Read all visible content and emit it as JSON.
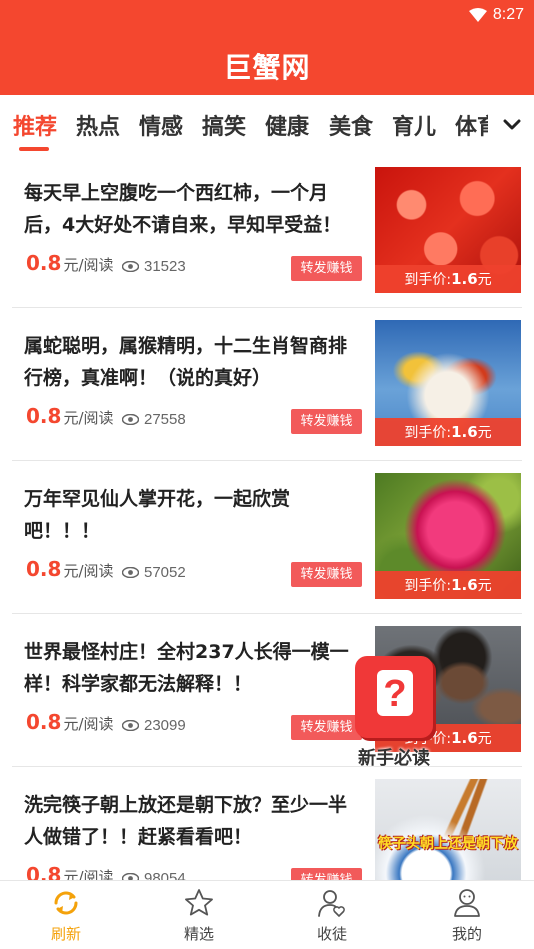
{
  "status": {
    "time": "8:27"
  },
  "header": {
    "title": "巨蟹网"
  },
  "tabs": [
    "推荐",
    "热点",
    "情感",
    "搞笑",
    "健康",
    "美食",
    "育儿",
    "体育"
  ],
  "articles": [
    {
      "title": "每天早上空腹吃一个西红柿，一个月后，4大好处不请自来，早知早受益！",
      "price": "0.8",
      "unit": "元/阅读",
      "views": "31523",
      "share": "转发赚钱",
      "cap_prefix": "到手价:",
      "cap_price": "1.6",
      "cap_unit": "元"
    },
    {
      "title": "属蛇聪明，属猴精明，十二生肖智商排行榜，真准啊！（说的真好）",
      "price": "0.8",
      "unit": "元/阅读",
      "views": "27558",
      "share": "转发赚钱",
      "cap_prefix": "到手价:",
      "cap_price": "1.6",
      "cap_unit": "元"
    },
    {
      "title": "万年罕见仙人掌开花，一起欣赏吧！！！",
      "price": "0.8",
      "unit": "元/阅读",
      "views": "57052",
      "share": "转发赚钱",
      "cap_prefix": "到手价:",
      "cap_price": "1.6",
      "cap_unit": "元"
    },
    {
      "title": "世界最怪村庄！全村237人长得一模一样！科学家都无法解释！！",
      "price": "0.8",
      "unit": "元/阅读",
      "views": "23099",
      "share": "转发赚钱",
      "cap_prefix": "到手价:",
      "cap_price": "1.6",
      "cap_unit": "元"
    },
    {
      "title": "洗完筷子朝上放还是朝下放？至少一半人做错了！！赶紧看看吧！",
      "price": "0.8",
      "unit": "元/阅读",
      "views": "98054",
      "share": "转发赚钱",
      "overlay": "筷子头朝上还是朝下放"
    }
  ],
  "help": {
    "label": "新手必读",
    "icon": "question-icon"
  },
  "nav": [
    {
      "label": "刷新",
      "icon": "refresh-icon"
    },
    {
      "label": "精选",
      "icon": "star-icon"
    },
    {
      "label": "收徒",
      "icon": "apprentice-icon"
    },
    {
      "label": "我的",
      "icon": "user-icon"
    }
  ],
  "colors": {
    "brand": "#f4472f",
    "share": "#f25a5a",
    "active_nav": "#f4a20b"
  }
}
